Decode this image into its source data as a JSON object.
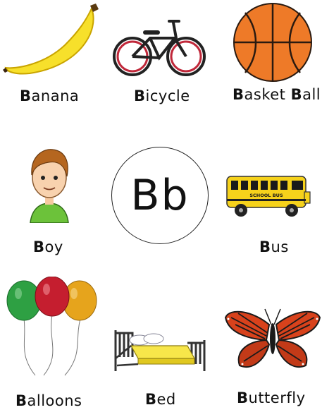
{
  "center": {
    "letters": "Bb"
  },
  "items": [
    {
      "first": "B",
      "rest": "anana"
    },
    {
      "first": "B",
      "rest": "icycle"
    },
    {
      "first": "B",
      "rest": "asket ",
      "first2": "B",
      "rest2": "all"
    },
    {
      "first": "B",
      "rest": "oy"
    },
    {
      "first": "B",
      "rest": "us"
    },
    {
      "first": "B",
      "rest": "alloons"
    },
    {
      "first": "B",
      "rest": "ed"
    },
    {
      "first": "B",
      "rest": "utterfly"
    }
  ],
  "bus_sign": "SCHOOL BUS"
}
